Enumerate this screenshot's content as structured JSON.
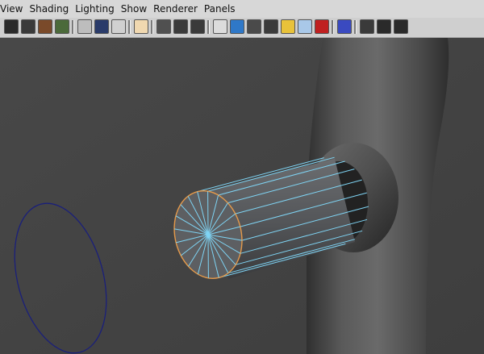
{
  "menus": [
    {
      "label": "View"
    },
    {
      "label": "Shading"
    },
    {
      "label": "Lighting"
    },
    {
      "label": "Show"
    },
    {
      "label": "Renderer"
    },
    {
      "label": "Panels"
    }
  ],
  "toolbar_buttons": [
    {
      "name": "select-camera-icon",
      "bg": "#2b2b2b"
    },
    {
      "name": "camera-attributes-icon",
      "bg": "#3a3a3a"
    },
    {
      "name": "bookmarks-icon",
      "bg": "#7a4a2a"
    },
    {
      "name": "image-plane-icon",
      "bg": "#4b6a3a"
    },
    {
      "name": "grid-icon",
      "bg": "#bdbdbd"
    },
    {
      "name": "film-gate-icon",
      "bg": "#2a3b6a"
    },
    {
      "name": "resolution-gate-icon",
      "bg": "#d0d0d0"
    },
    {
      "name": "gate-mask-icon",
      "bg": "#f0d8b0"
    },
    {
      "name": "field-chart-icon",
      "bg": "#505050"
    },
    {
      "name": "safe-action-icon",
      "bg": "#3a3a3a"
    },
    {
      "name": "safe-title-icon",
      "bg": "#3a3a3a"
    },
    {
      "name": "wireframe-icon",
      "bg": "#dcdcdc"
    },
    {
      "name": "smooth-shade-icon",
      "bg": "#2f78c8"
    },
    {
      "name": "flat-shade-icon",
      "bg": "#4a4a4a"
    },
    {
      "name": "shade-wireframe-icon",
      "bg": "#3b3b3b"
    },
    {
      "name": "use-lights-icon",
      "bg": "#e8c23a"
    },
    {
      "name": "xray-icon",
      "bg": "#a9c8e8"
    },
    {
      "name": "textured-icon",
      "bg": "#c02020"
    },
    {
      "name": "isolate-select-icon",
      "bg": "#3a4ac0"
    },
    {
      "name": "backface-cull-icon",
      "bg": "#3a3a3a"
    },
    {
      "name": "grid-toggle-icon",
      "bg": "#2a2a2a"
    },
    {
      "name": "depth-of-field-icon",
      "bg": "#2a2a2a"
    }
  ],
  "colors": {
    "viewport_background": "#444444",
    "wireframe_highlight": "#7fd4f4",
    "cylinder_shaded": "#55575a",
    "selection_outline": "#e69a4a",
    "curve": "#1a1f7a"
  }
}
